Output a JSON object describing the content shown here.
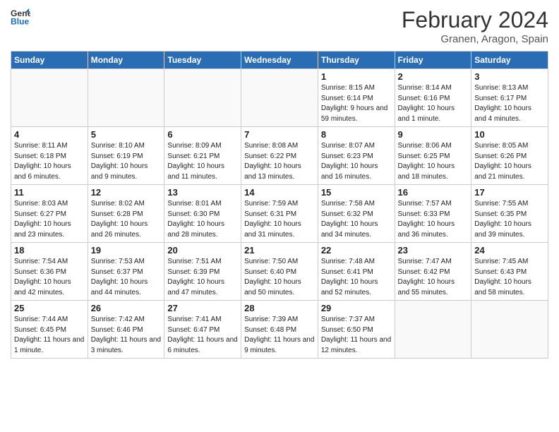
{
  "header": {
    "logo_line1": "General",
    "logo_line2": "Blue",
    "month": "February 2024",
    "location": "Granen, Aragon, Spain"
  },
  "days_of_week": [
    "Sunday",
    "Monday",
    "Tuesday",
    "Wednesday",
    "Thursday",
    "Friday",
    "Saturday"
  ],
  "weeks": [
    [
      {
        "num": "",
        "info": ""
      },
      {
        "num": "",
        "info": ""
      },
      {
        "num": "",
        "info": ""
      },
      {
        "num": "",
        "info": ""
      },
      {
        "num": "1",
        "info": "Sunrise: 8:15 AM\nSunset: 6:14 PM\nDaylight: 9 hours and 59 minutes."
      },
      {
        "num": "2",
        "info": "Sunrise: 8:14 AM\nSunset: 6:16 PM\nDaylight: 10 hours and 1 minute."
      },
      {
        "num": "3",
        "info": "Sunrise: 8:13 AM\nSunset: 6:17 PM\nDaylight: 10 hours and 4 minutes."
      }
    ],
    [
      {
        "num": "4",
        "info": "Sunrise: 8:11 AM\nSunset: 6:18 PM\nDaylight: 10 hours and 6 minutes."
      },
      {
        "num": "5",
        "info": "Sunrise: 8:10 AM\nSunset: 6:19 PM\nDaylight: 10 hours and 9 minutes."
      },
      {
        "num": "6",
        "info": "Sunrise: 8:09 AM\nSunset: 6:21 PM\nDaylight: 10 hours and 11 minutes."
      },
      {
        "num": "7",
        "info": "Sunrise: 8:08 AM\nSunset: 6:22 PM\nDaylight: 10 hours and 13 minutes."
      },
      {
        "num": "8",
        "info": "Sunrise: 8:07 AM\nSunset: 6:23 PM\nDaylight: 10 hours and 16 minutes."
      },
      {
        "num": "9",
        "info": "Sunrise: 8:06 AM\nSunset: 6:25 PM\nDaylight: 10 hours and 18 minutes."
      },
      {
        "num": "10",
        "info": "Sunrise: 8:05 AM\nSunset: 6:26 PM\nDaylight: 10 hours and 21 minutes."
      }
    ],
    [
      {
        "num": "11",
        "info": "Sunrise: 8:03 AM\nSunset: 6:27 PM\nDaylight: 10 hours and 23 minutes."
      },
      {
        "num": "12",
        "info": "Sunrise: 8:02 AM\nSunset: 6:28 PM\nDaylight: 10 hours and 26 minutes."
      },
      {
        "num": "13",
        "info": "Sunrise: 8:01 AM\nSunset: 6:30 PM\nDaylight: 10 hours and 28 minutes."
      },
      {
        "num": "14",
        "info": "Sunrise: 7:59 AM\nSunset: 6:31 PM\nDaylight: 10 hours and 31 minutes."
      },
      {
        "num": "15",
        "info": "Sunrise: 7:58 AM\nSunset: 6:32 PM\nDaylight: 10 hours and 34 minutes."
      },
      {
        "num": "16",
        "info": "Sunrise: 7:57 AM\nSunset: 6:33 PM\nDaylight: 10 hours and 36 minutes."
      },
      {
        "num": "17",
        "info": "Sunrise: 7:55 AM\nSunset: 6:35 PM\nDaylight: 10 hours and 39 minutes."
      }
    ],
    [
      {
        "num": "18",
        "info": "Sunrise: 7:54 AM\nSunset: 6:36 PM\nDaylight: 10 hours and 42 minutes."
      },
      {
        "num": "19",
        "info": "Sunrise: 7:53 AM\nSunset: 6:37 PM\nDaylight: 10 hours and 44 minutes."
      },
      {
        "num": "20",
        "info": "Sunrise: 7:51 AM\nSunset: 6:39 PM\nDaylight: 10 hours and 47 minutes."
      },
      {
        "num": "21",
        "info": "Sunrise: 7:50 AM\nSunset: 6:40 PM\nDaylight: 10 hours and 50 minutes."
      },
      {
        "num": "22",
        "info": "Sunrise: 7:48 AM\nSunset: 6:41 PM\nDaylight: 10 hours and 52 minutes."
      },
      {
        "num": "23",
        "info": "Sunrise: 7:47 AM\nSunset: 6:42 PM\nDaylight: 10 hours and 55 minutes."
      },
      {
        "num": "24",
        "info": "Sunrise: 7:45 AM\nSunset: 6:43 PM\nDaylight: 10 hours and 58 minutes."
      }
    ],
    [
      {
        "num": "25",
        "info": "Sunrise: 7:44 AM\nSunset: 6:45 PM\nDaylight: 11 hours and 1 minute."
      },
      {
        "num": "26",
        "info": "Sunrise: 7:42 AM\nSunset: 6:46 PM\nDaylight: 11 hours and 3 minutes."
      },
      {
        "num": "27",
        "info": "Sunrise: 7:41 AM\nSunset: 6:47 PM\nDaylight: 11 hours and 6 minutes."
      },
      {
        "num": "28",
        "info": "Sunrise: 7:39 AM\nSunset: 6:48 PM\nDaylight: 11 hours and 9 minutes."
      },
      {
        "num": "29",
        "info": "Sunrise: 7:37 AM\nSunset: 6:50 PM\nDaylight: 11 hours and 12 minutes."
      },
      {
        "num": "",
        "info": ""
      },
      {
        "num": "",
        "info": ""
      }
    ]
  ]
}
